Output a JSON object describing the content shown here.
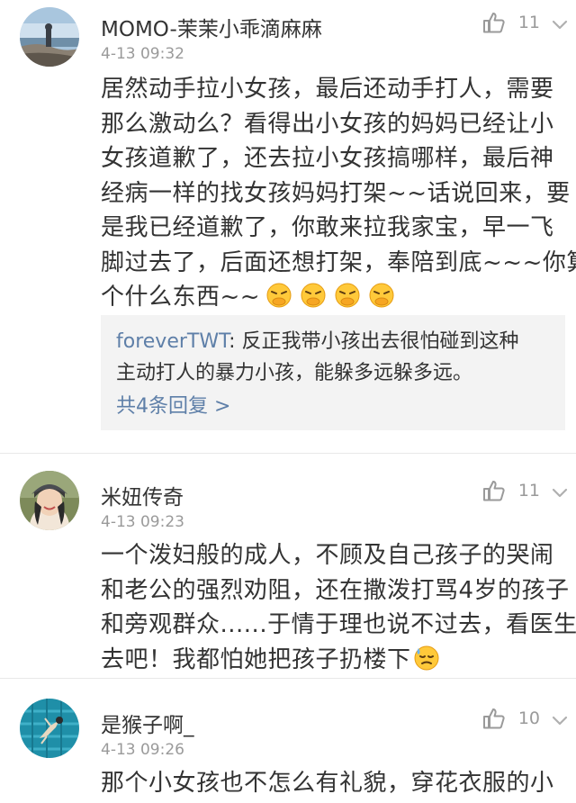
{
  "comments": [
    {
      "username": "MOMO-茉茉小乖滴麻麻",
      "time": "4-13 09:32",
      "likes": "11",
      "lines": [
        "居然动手拉小女孩，最后还动手打人，需要",
        "那么激动么？看得出小女孩的妈妈已经让小",
        "女孩道歉了，还去拉小女孩搞哪样，最后神",
        "经病一样的找女孩妈妈打架~~话说回来，要",
        "是我已经道歉了，你敢来拉我家宝，早一飞",
        "脚过去了，后面还想打架，奉陪到底~~~你算",
        "个什么东西~~"
      ],
      "emoji": "angry-covering-mouth-emoji",
      "emoji_count": 4,
      "reply": {
        "user": "foreverTWT",
        "separator": ": ",
        "line1": "反正我带小孩出去很怕碰到这种",
        "line2": "主动打人的暴力小孩，能躲多远躲多远。",
        "more": "共4条回复 >"
      }
    },
    {
      "username": "米妞传奇",
      "time": "4-13 09:23",
      "likes": "11",
      "lines": [
        "一个泼妇般的成人，不顾及自己孩子的哭闹",
        "和老公的强烈劝阻，还在撒泼打骂4岁的孩子",
        "和旁观群众......于情于理也说不过去，看医生",
        "去吧！我都怕她把孩子扔楼下"
      ],
      "emoji": "sweat-face-emoji"
    },
    {
      "username": "是猴子啊_",
      "time": "4-13 09:26",
      "likes": "10",
      "lines": [
        "那个小女孩也不怎么有礼貌，穿花衣服的小"
      ]
    }
  ],
  "colors": {
    "link": "#5e7fa8",
    "text": "#333333",
    "meta": "#9a9a9a",
    "reply_bg": "#f3f3f3",
    "divider": "#e8e8e8"
  },
  "icons": {
    "like": "thumbs-up-icon",
    "menu": "chevron-down-icon"
  }
}
